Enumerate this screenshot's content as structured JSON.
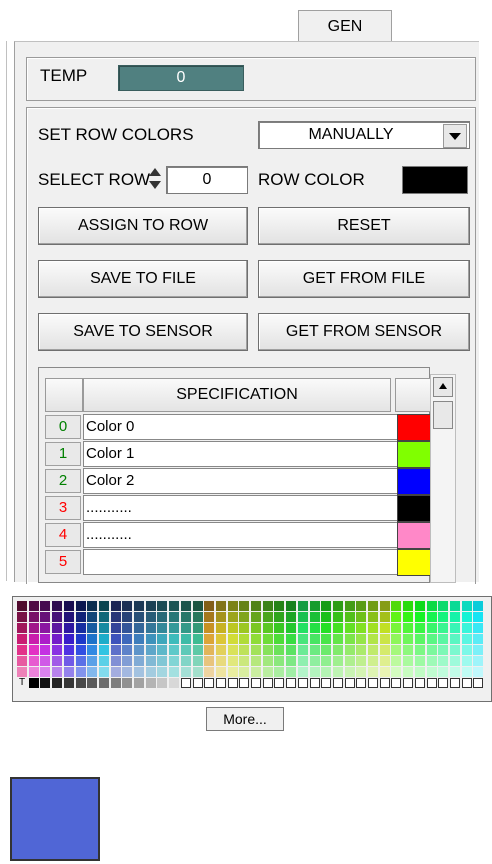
{
  "tab": {
    "label": "GEN"
  },
  "temp": {
    "label": "TEMP",
    "value": "0"
  },
  "set_row_colors": {
    "label": "SET ROW COLORS",
    "value": "MANUALLY"
  },
  "select_row": {
    "label": "SELECT ROW",
    "value": "0"
  },
  "row_color": {
    "label": "ROW COLOR",
    "color": "#000000"
  },
  "buttons": {
    "assign": "ASSIGN TO ROW",
    "reset": "RESET",
    "save_file": "SAVE TO FILE",
    "get_file": "GET FROM FILE",
    "save_sensor": "SAVE TO SENSOR",
    "get_sensor": "GET FROM SENSOR"
  },
  "table": {
    "header": "SPECIFICATION",
    "rows": [
      {
        "idx": "0",
        "name": "Color 0",
        "color": "#ff0000",
        "idx_color": "#008000"
      },
      {
        "idx": "1",
        "name": "Color 1",
        "color": "#80ff00",
        "idx_color": "#008000"
      },
      {
        "idx": "2",
        "name": "Color 2",
        "color": "#0000ff",
        "idx_color": "#008000"
      },
      {
        "idx": "3",
        "name": "...........",
        "color": "#000000",
        "idx_color": "#ff0000"
      },
      {
        "idx": "4",
        "name": "...........",
        "color": "#ff88c8",
        "idx_color": "#ff0000"
      },
      {
        "idx": "5",
        "name": "",
        "color": "#ffff00",
        "idx_color": "#ff0000"
      }
    ]
  },
  "palette": {
    "more_label": "More...",
    "t_label": "T"
  },
  "selected_color": "#5066d6"
}
